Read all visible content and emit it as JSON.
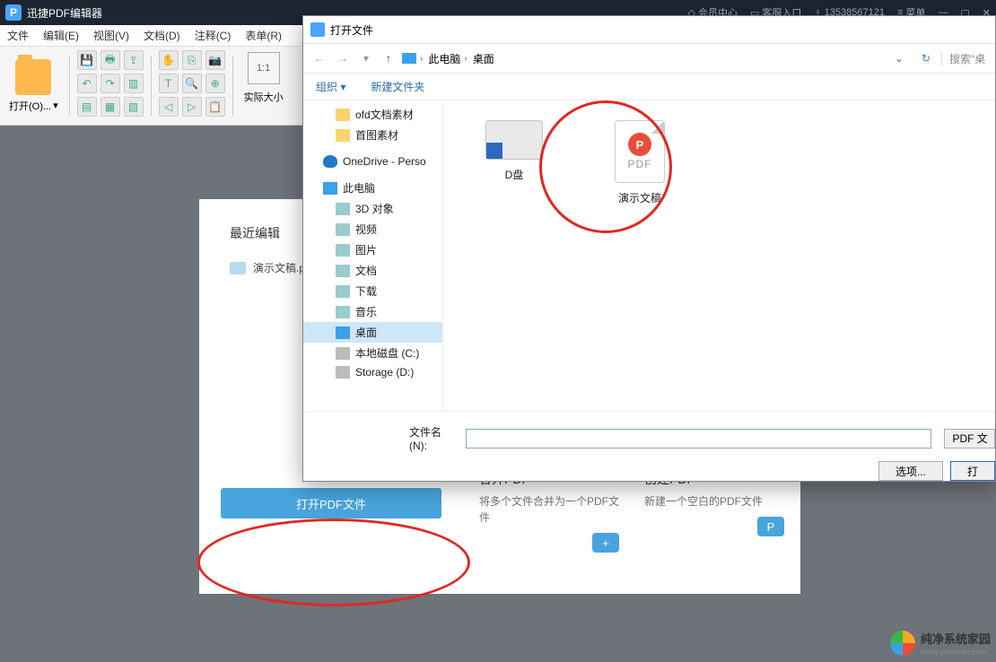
{
  "app": {
    "title": "迅捷PDF编辑器",
    "header_links": {
      "vip": "会员中心",
      "customer": "客服入口",
      "phone": "13538567121",
      "menu": "菜单"
    }
  },
  "menu": {
    "file": "文件",
    "edit": "编辑(E)",
    "view": "视图(V)",
    "doc": "文档(D)",
    "annot": "注释(C)",
    "form": "表单(R)"
  },
  "toolbar": {
    "open_label": "打开(O)...",
    "actual_size": "实际大小",
    "ratio": "1:1"
  },
  "start": {
    "recent_title": "最近编辑",
    "recent_item": "演示文稿.p",
    "open_pdf_btn": "打开PDF文件",
    "merge": {
      "title": "合并PDF",
      "desc": "将多个文件合并为一个PDF文件",
      "icon": "+"
    },
    "create": {
      "title": "创建PDF",
      "desc": "新建一个空白的PDF文件",
      "icon": "P"
    }
  },
  "dialog": {
    "title": "打开文件",
    "path": {
      "root": "此电脑",
      "folder": "桌面"
    },
    "search_placeholder": "搜索\"桌",
    "organize": "组织 ▾",
    "new_folder": "新建文件夹",
    "tree": {
      "ofd": "ofd文档素材",
      "sutu": "首图素材",
      "onedrive": "OneDrive - Perso",
      "this_pc": "此电脑",
      "obj3d": "3D 对象",
      "video": "视频",
      "pictures": "图片",
      "documents": "文档",
      "downloads": "下载",
      "music": "音乐",
      "desktop": "桌面",
      "cdisk": "本地磁盘 (C:)",
      "storage": "Storage (D:)"
    },
    "items": {
      "ddisk": "D盘",
      "presentation": "演示文稿",
      "pdf_label": "PDF"
    },
    "filename_label": "文件名(N):",
    "file_type": "PDF 文",
    "options_btn": "选项...",
    "open_btn": "打"
  },
  "watermark": {
    "text": "纯净系统家园",
    "url": "www.yidaimei.com"
  }
}
